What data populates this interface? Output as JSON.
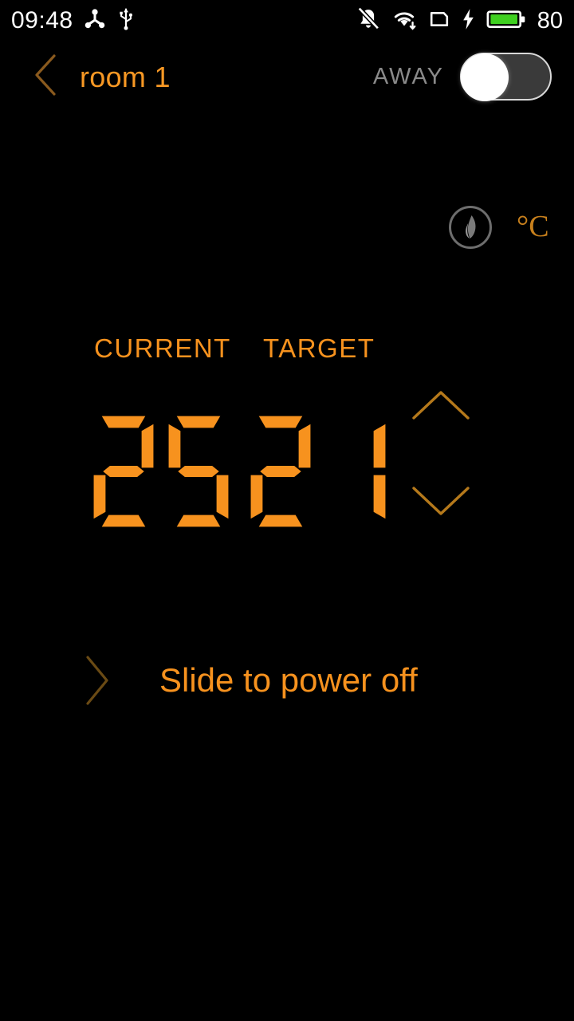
{
  "status_bar": {
    "time": "09:48",
    "battery_percent": "80",
    "icons": [
      {
        "name": "share-nodes-icon",
        "position": "left"
      },
      {
        "name": "usb-icon",
        "position": "left"
      },
      {
        "name": "mute-bell-icon",
        "position": "right"
      },
      {
        "name": "wifi-download-icon",
        "position": "right"
      },
      {
        "name": "sim-card-icon",
        "position": "right"
      },
      {
        "name": "charging-bolt-icon",
        "position": "right"
      },
      {
        "name": "battery-icon",
        "position": "right"
      }
    ],
    "battery_color": "#3FD020",
    "text_color": "#FFFFFF"
  },
  "header": {
    "back_icon": "chevron-left-icon",
    "title": "room 1",
    "away_label": "AWAY",
    "away_toggle_state": "off",
    "title_color": "#F79824",
    "away_label_color": "#8A8A8A"
  },
  "mode_row": {
    "flame_icon": "flame-icon",
    "flame_state": "inactive",
    "flame_color": "#6D6D6D",
    "unit": "°C",
    "unit_color": "#C8801C"
  },
  "temperature": {
    "current_label": "CURRENT",
    "current_value": "25",
    "target_label": "TARGET",
    "target_value": "21",
    "digit_color": "#F7921E",
    "label_color": "#F7921E",
    "stepper": {
      "up_icon": "chevron-up-icon",
      "down_icon": "chevron-down-icon",
      "color": "#B5791B"
    }
  },
  "power_slider": {
    "chevron_icon": "chevron-right-icon",
    "label": "Slide to power off",
    "label_color": "#F7921E",
    "chevron_color": "#6A4A14"
  },
  "theme": {
    "background": "#000000",
    "accent": "#F7921E"
  }
}
